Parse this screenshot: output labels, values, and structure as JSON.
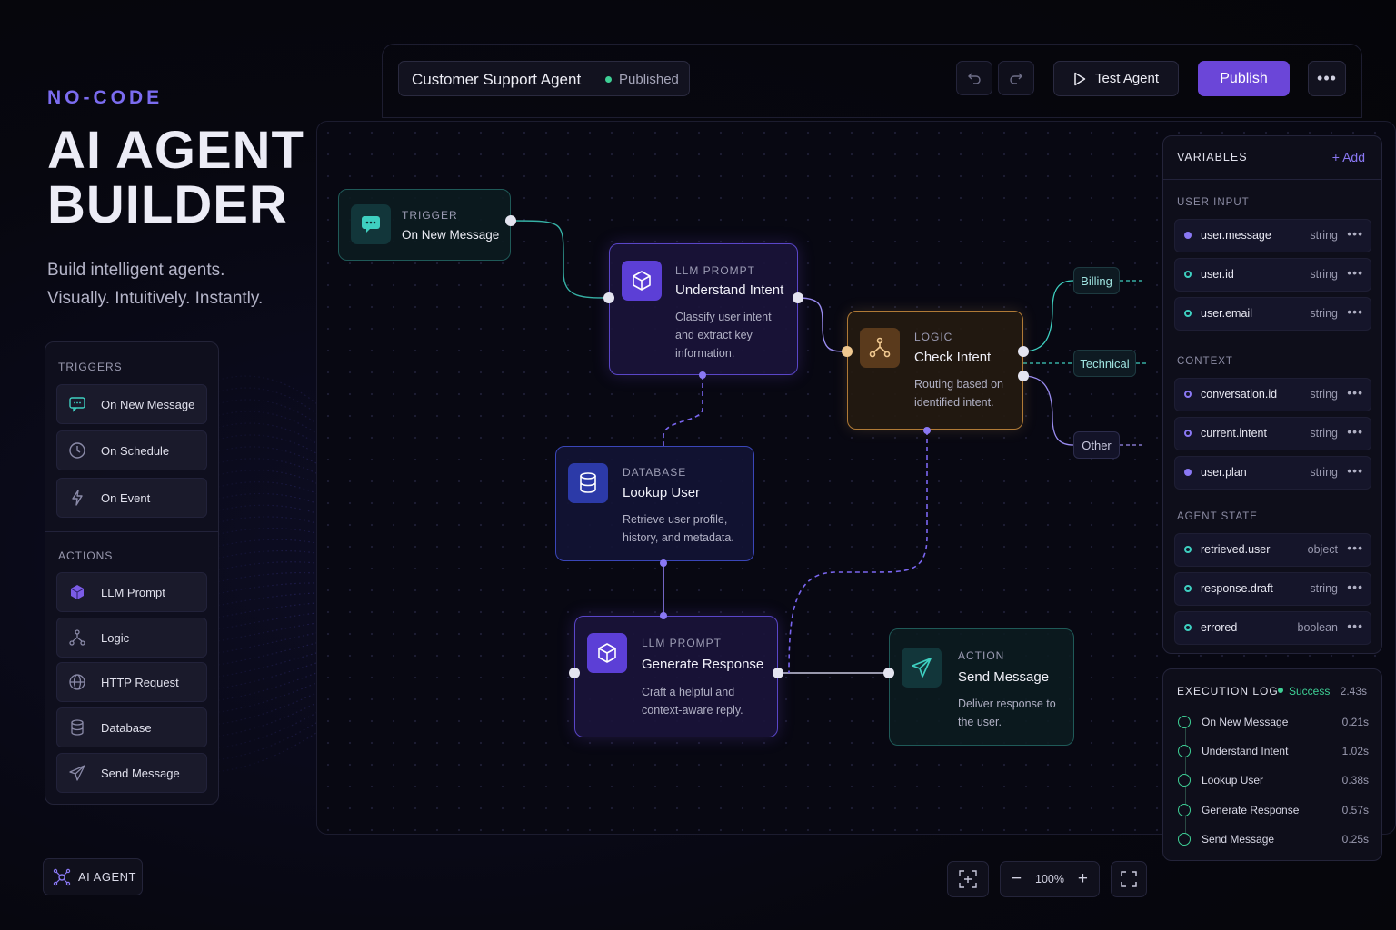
{
  "hero": {
    "eyebrow": "NO-CODE",
    "title_line1": "AI AGENT",
    "title_line2": "BUILDER",
    "tagline_line1": "Build intelligent agents.",
    "tagline_line2": "Visually. Intuitively. Instantly."
  },
  "palette": {
    "triggers_heading": "TRIGGERS",
    "triggers": [
      {
        "label": "On New Message",
        "icon": "chat-icon"
      },
      {
        "label": "On Schedule",
        "icon": "clock-icon"
      },
      {
        "label": "On Event",
        "icon": "bolt-icon"
      }
    ],
    "actions_heading": "ACTIONS",
    "actions": [
      {
        "label": "LLM Prompt",
        "icon": "cube-icon"
      },
      {
        "label": "Logic",
        "icon": "branch-icon"
      },
      {
        "label": "HTTP Request",
        "icon": "globe-icon"
      },
      {
        "label": "Database",
        "icon": "database-icon"
      },
      {
        "label": "Send Message",
        "icon": "send-icon"
      }
    ]
  },
  "header": {
    "agent_name": "Customer Support Agent",
    "status": "Published",
    "test_label": "Test Agent",
    "publish_label": "Publish",
    "more_label": "•••"
  },
  "nodes": {
    "trigger": {
      "type": "TRIGGER",
      "title": "On New Message"
    },
    "understand": {
      "type": "LLM PROMPT",
      "title": "Understand Intent",
      "desc1": "Classify user intent",
      "desc2": "and extract key",
      "desc3": "information."
    },
    "check": {
      "type": "LOGIC",
      "title": "Check Intent",
      "desc1": "Routing based on",
      "desc2": "identified intent."
    },
    "lookup": {
      "type": "DATABASE",
      "title": "Lookup User",
      "desc1": "Retrieve user profile,",
      "desc2": "history, and metadata."
    },
    "generate": {
      "type": "LLM PROMPT",
      "title": "Generate Response",
      "desc1": "Craft a helpful and",
      "desc2": "context-aware reply."
    },
    "send": {
      "type": "ACTION",
      "title": "Send Message",
      "desc1": "Deliver response to",
      "desc2": "the user."
    }
  },
  "branches": [
    "Billing",
    "Technical",
    "Other"
  ],
  "variables": {
    "title": "VARIABLES",
    "add_label": "+ Add",
    "sections": [
      {
        "heading": "USER INPUT",
        "rows": [
          {
            "name": "user.message",
            "type": "string"
          },
          {
            "name": "user.id",
            "type": "string"
          },
          {
            "name": "user.email",
            "type": "string"
          }
        ]
      },
      {
        "heading": "CONTEXT",
        "rows": [
          {
            "name": "conversation.id",
            "type": "string"
          },
          {
            "name": "current.intent",
            "type": "string"
          },
          {
            "name": "user.plan",
            "type": "string"
          }
        ]
      },
      {
        "heading": "AGENT STATE",
        "rows": [
          {
            "name": "retrieved.user",
            "type": "object"
          },
          {
            "name": "response.draft",
            "type": "string"
          },
          {
            "name": "errored",
            "type": "boolean"
          }
        ]
      }
    ]
  },
  "execution_log": {
    "title": "EXECUTION LOG",
    "status": "Success",
    "total": "2.43s",
    "steps": [
      {
        "name": "On New Message",
        "time": "0.21s"
      },
      {
        "name": "Understand Intent",
        "time": "1.02s"
      },
      {
        "name": "Lookup User",
        "time": "0.38s"
      },
      {
        "name": "Generate Response",
        "time": "0.57s"
      },
      {
        "name": "Send Message",
        "time": "0.25s"
      }
    ]
  },
  "footer": {
    "badge_label": "AI AGENT",
    "zoom": "100%"
  },
  "colors": {
    "accent": "#6b46d8",
    "teal": "#3ecfc0",
    "amber": "#d9a55a",
    "success": "#3ecf95"
  }
}
